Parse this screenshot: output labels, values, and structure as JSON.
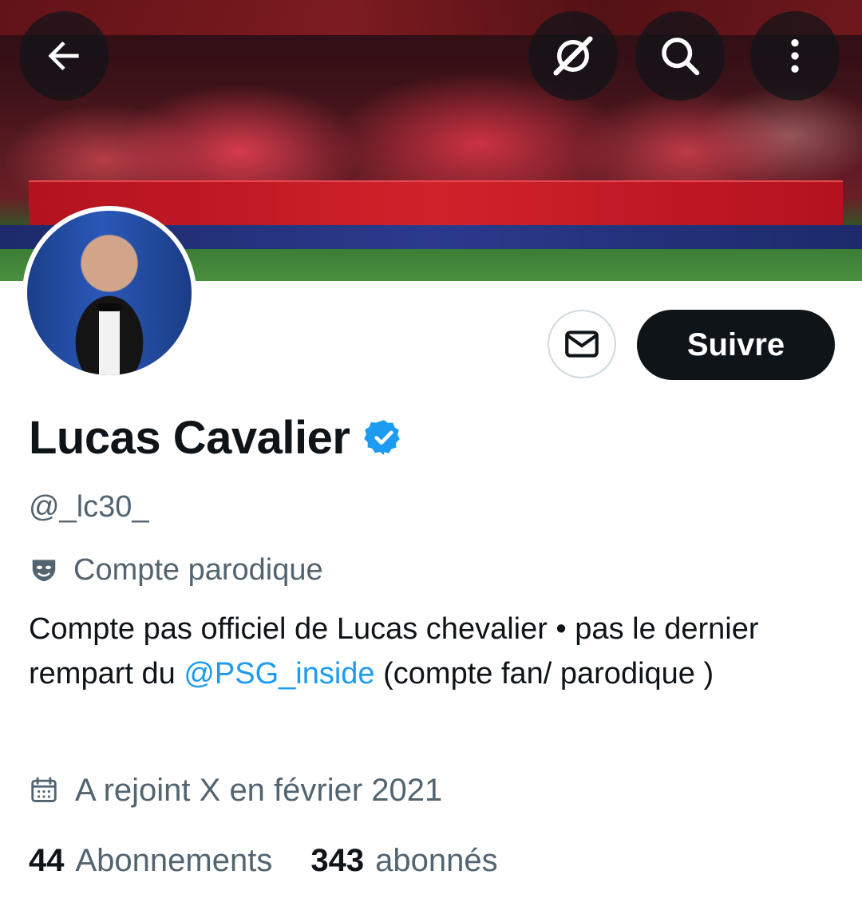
{
  "profile": {
    "display_name": "Lucas Cavalier",
    "handle": "@_lc30_",
    "parody_label": "Compte parodique",
    "bio_part1": "Compte pas officiel de Lucas chevalier • pas le dernier rempart du ",
    "bio_mention": "@PSG_inside",
    "bio_part2": " (compte fan/ parodique )",
    "joined": "A rejoint X en février 2021",
    "following_count": "44",
    "following_label": "Abonnements",
    "followers_count": "343",
    "followers_label": "abonnés",
    "verified": true
  },
  "actions": {
    "follow_label": "Suivre"
  },
  "icons": {
    "back": "arrow-left-icon",
    "grok": "grok-icon",
    "search": "search-icon",
    "more": "more-vertical-icon",
    "message": "mail-icon",
    "verified": "verified-badge-icon",
    "parody": "mask-icon",
    "calendar": "calendar-icon"
  },
  "colors": {
    "text_primary": "#0f1419",
    "text_secondary": "#536471",
    "accent": "#1d9bf0",
    "button_dark": "#0f1419"
  }
}
